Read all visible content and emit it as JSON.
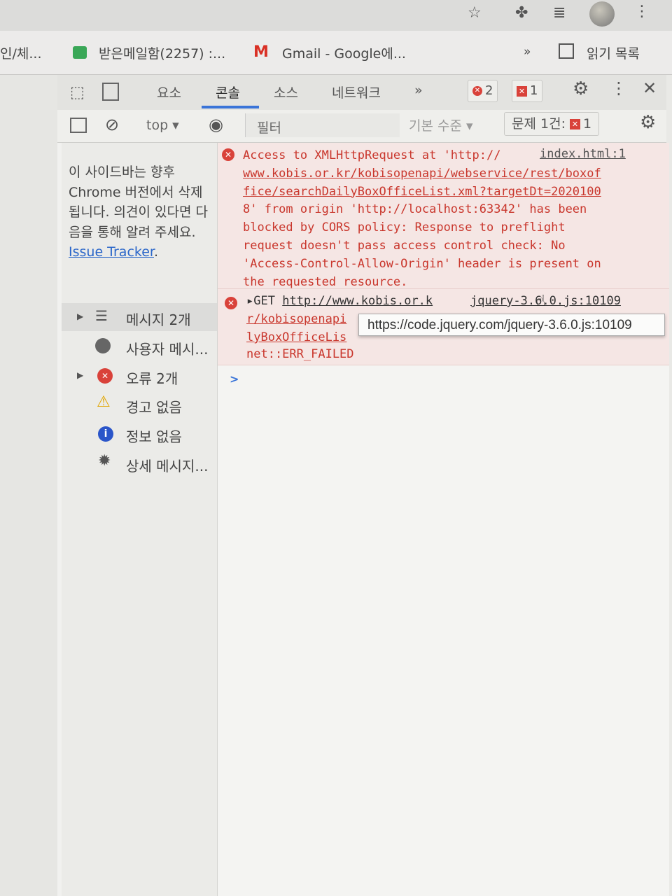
{
  "browser": {
    "toolbar_icons": [
      "star-icon",
      "extensions-icon",
      "media-queue-icon",
      "profile-avatar",
      "more-menu-icon"
    ],
    "bookmarks": [
      {
        "label": "인/체...",
        "icon": "none"
      },
      {
        "label": "받은메일함(2257) :...",
        "icon": "mail-icon"
      },
      {
        "label": "Gmail - Google에...",
        "icon": "gmail-icon"
      }
    ],
    "bookmarks_more": "»",
    "reading_list": "읽기 목록"
  },
  "devtools": {
    "tabs": [
      "요소",
      "콘솔",
      "소스",
      "네트워크"
    ],
    "tabs_more": "»",
    "active_tab": "콘솔",
    "error_count": "2",
    "issue_count": "1",
    "subbar": {
      "context": "top",
      "filter_placeholder": "필터",
      "level": "기본 수준",
      "issues_label": "문제 1건:",
      "issues_count": "1"
    },
    "sidebar": {
      "note_text": "이 사이드바는 향후 Chrome 버전에서 삭제됩니다. 의견이 있다면 다음을 통해 알려 주세요.",
      "note_link": "Issue Tracker",
      "note_end": ".",
      "items": [
        {
          "label": "메시지 2개",
          "icon": "list-icon"
        },
        {
          "label": "사용자 메시...",
          "icon": "user-icon"
        },
        {
          "label": "오류 2개",
          "icon": "error-icon"
        },
        {
          "label": "경고 없음",
          "icon": "warning-icon"
        },
        {
          "label": "정보 없음",
          "icon": "info-icon"
        },
        {
          "label": "상세 메시지...",
          "icon": "bug-icon"
        }
      ]
    },
    "console": {
      "error1": {
        "lines": [
          "Access to XMLHttpRequest at 'http://",
          "www.kobis.or.kr/kobisopenapi/webservice/rest/boxof",
          "fice/searchDailyBoxOfficeList.xml?targetDt=2020100",
          "8' from origin 'http://localhost:63342' has been",
          "blocked by CORS policy: Response to preflight",
          "request doesn't pass access control check: No",
          "'Access-Control-Allow-Origin' header is present on",
          "the requested resource."
        ],
        "source": "index.html:1"
      },
      "error2": {
        "method": "GET",
        "url_part1": "http://www.kobis.or.k",
        "url_part2": "r/kobisopenapi",
        "url_part3": "lyBoxOfficeLis",
        "status": "net::ERR_FAILED",
        "source": "jquery-3.6.0.js:10109"
      },
      "tooltip": "https://code.jquery.com/jquery-3.6.0.js:10109",
      "prompt": ">"
    }
  }
}
